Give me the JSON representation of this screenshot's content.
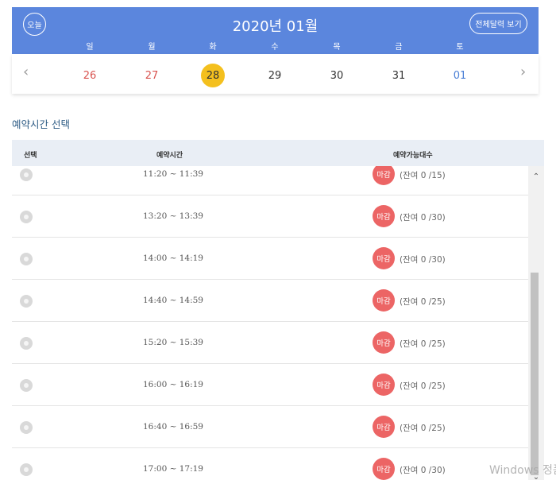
{
  "calendar": {
    "today_label": "오늘",
    "month_title": "2020년 01월",
    "full_calendar_label": "전체달력 보기",
    "weekdays": [
      "일",
      "월",
      "화",
      "수",
      "목",
      "금",
      "토"
    ],
    "prev_arrow": "‹",
    "next_arrow": "›",
    "days": [
      "26",
      "27",
      "28",
      "29",
      "30",
      "31",
      "01"
    ],
    "selected_day": "28"
  },
  "section_title": "예약시간 선택",
  "table": {
    "headers": [
      "선택",
      "예약시간",
      "예약가능대수"
    ],
    "rows": [
      {
        "time": "11:20 ~ 11:39",
        "status": "마감",
        "remain": "(잔여  0 /15)"
      },
      {
        "time": "13:20 ~ 13:39",
        "status": "마감",
        "remain": "(잔여  0 /30)"
      },
      {
        "time": "14:00 ~ 14:19",
        "status": "마감",
        "remain": "(잔여  0 /30)"
      },
      {
        "time": "14:40 ~ 14:59",
        "status": "마감",
        "remain": "(잔여  0 /25)"
      },
      {
        "time": "15:20 ~ 15:39",
        "status": "마감",
        "remain": "(잔여  0 /25)"
      },
      {
        "time": "16:00 ~ 16:19",
        "status": "마감",
        "remain": "(잔여  0 /25)"
      },
      {
        "time": "16:40 ~ 16:59",
        "status": "마감",
        "remain": "(잔여  0 /25)"
      },
      {
        "time": "17:00 ~ 17:19",
        "status": "마감",
        "remain": "(잔여  0 /30)"
      }
    ]
  },
  "watermark": "Windows 정품",
  "colors": {
    "header_blue": "#5b86dd",
    "selected_yellow": "#f4c01e",
    "sunday_red": "#d9534f",
    "saturday_blue": "#4a7fd6",
    "closed_badge": "#ec6565",
    "section_title": "#2f5d86"
  },
  "icons": {
    "prev": "chevron-left-icon",
    "next": "chevron-right-icon",
    "radio": "radio-icon",
    "scroll_up": "chevron-up-icon",
    "scroll_down": "chevron-down-icon"
  }
}
